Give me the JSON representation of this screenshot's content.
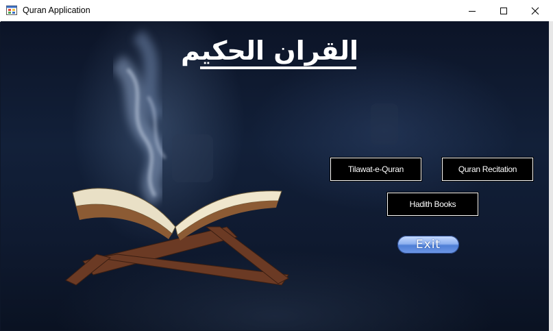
{
  "window": {
    "title": "Quran Application",
    "icon": "app-window-icon"
  },
  "controls": {
    "minimize_icon": "minimize-icon",
    "maximize_icon": "maximize-icon",
    "close_icon": "close-icon"
  },
  "main": {
    "heading": "القران الحكيم",
    "buttons": {
      "tilawat": "Tilawat-e-Quran",
      "recitation": "Quran Recitation",
      "hadith": "Hadith Books",
      "exit": "Exit"
    }
  },
  "colors": {
    "background": "#0e1729",
    "button_bg": "#000000",
    "button_border": "#ffffff",
    "exit_accent": "#6f98e6"
  }
}
